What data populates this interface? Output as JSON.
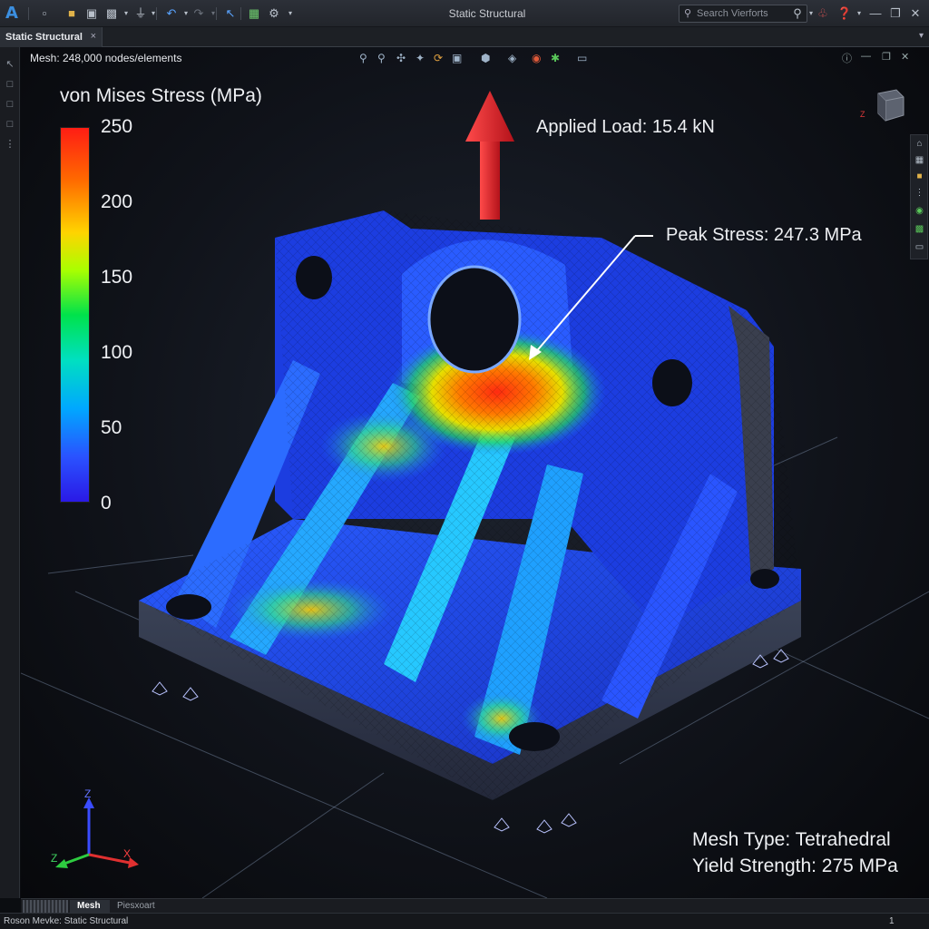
{
  "window": {
    "title": "Static Structural",
    "search_placeholder": "Search Vierforts",
    "toolbar_icons": [
      "app-logo-icon",
      "new-file-icon",
      "open-folder-icon",
      "save-icon",
      "print-icon",
      "stamp-icon",
      "undo-icon",
      "redo-icon",
      "select-cursor-icon",
      "grid-select-icon",
      "settings-gear-icon"
    ],
    "right_icons": [
      "notification-bell-icon",
      "help-icon",
      "minimize-icon",
      "restore-icon",
      "close-icon"
    ]
  },
  "tabs": [
    {
      "label": "Static Structural",
      "close": "×"
    }
  ],
  "viewport": {
    "mesh_info": "Mesh: 248,000 nodes/elements",
    "legend": {
      "title": "von Mises Stress (MPa)",
      "ticks": [
        "250",
        "200",
        "150",
        "100",
        "50",
        "0"
      ],
      "colors": [
        "#ff1d14",
        "#ff6a00",
        "#ffd400",
        "#aaff00",
        "#00e24b",
        "#00e0c0",
        "#00a8ff",
        "#2a52ff",
        "#2a19e6"
      ]
    },
    "applied_load": "Applied Load: 15.4 kN",
    "peak_stress": "Peak Stress: 247.3 MPa",
    "mesh_type": "Mesh Type: Tetrahedral",
    "yield_strength": "Yield Strength: 275 MPa",
    "triad": {
      "z": "Z",
      "x": "X",
      "y": "Z"
    },
    "navcube_label": "Z"
  },
  "bottom_tabs": [
    {
      "label": "Mesh"
    },
    {
      "label": "Piesxoart"
    }
  ],
  "status": {
    "left": "Roson Mevke: Static Structural",
    "page": "1"
  }
}
